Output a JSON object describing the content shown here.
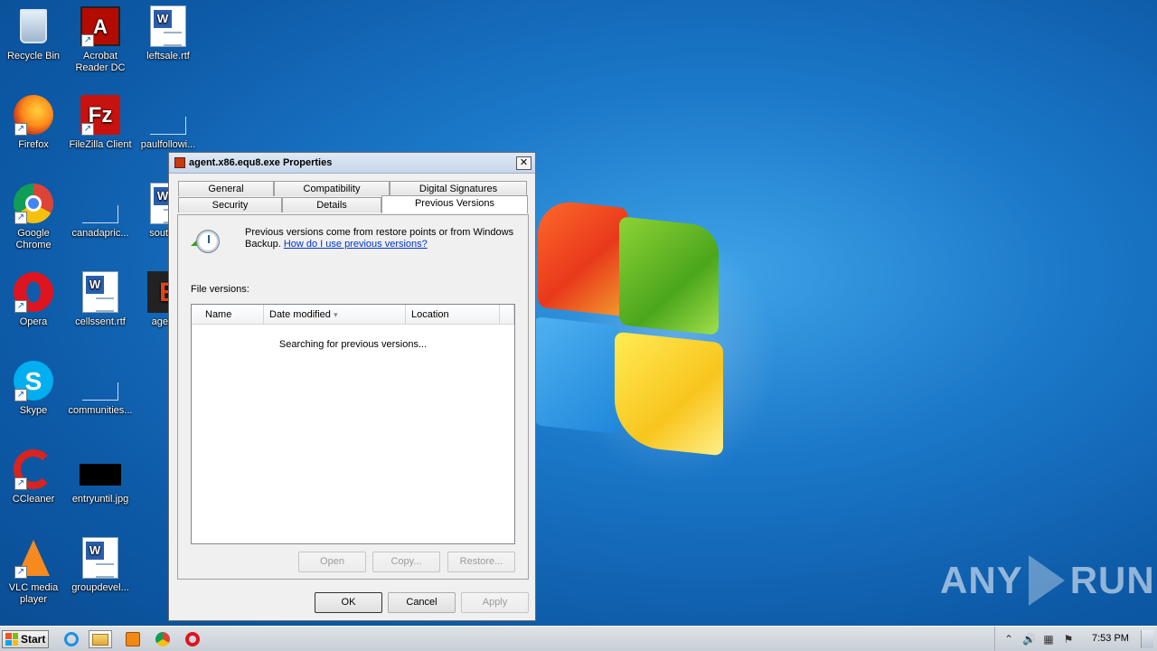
{
  "desktop": {
    "icons": [
      {
        "label": "Recycle Bin",
        "icon": "recycle-bin-icon"
      },
      {
        "label": "Acrobat Reader DC",
        "icon": "acrobat-icon"
      },
      {
        "label": "leftsale.rtf",
        "icon": "word-doc-icon"
      },
      {
        "label": "Firefox",
        "icon": "firefox-icon"
      },
      {
        "label": "FileZilla Client",
        "icon": "filezilla-icon"
      },
      {
        "label": "paulfollowi...",
        "icon": "file-icon"
      },
      {
        "label": "Google Chrome",
        "icon": "chrome-icon"
      },
      {
        "label": "canadapric...",
        "icon": "file-icon"
      },
      {
        "label": "souths...",
        "icon": "word-doc-icon"
      },
      {
        "label": "Opera",
        "icon": "opera-icon"
      },
      {
        "label": "cellssent.rtf",
        "icon": "word-doc-icon"
      },
      {
        "label": "agent...",
        "icon": "agent-exe-icon"
      },
      {
        "label": "Skype",
        "icon": "skype-icon"
      },
      {
        "label": "communities...",
        "icon": "file-icon"
      },
      {
        "label": "CCleaner",
        "icon": "ccleaner-icon"
      },
      {
        "label": "entryuntil.jpg",
        "icon": "image-icon"
      },
      {
        "label": "VLC media player",
        "icon": "vlc-icon"
      },
      {
        "label": "groupdevel...",
        "icon": "word-doc-icon"
      }
    ]
  },
  "dialog": {
    "title": "agent.x86.equ8.exe Properties",
    "close_label": "✕",
    "tabs": {
      "general": "General",
      "compatibility": "Compatibility",
      "digital_signatures": "Digital Signatures",
      "security": "Security",
      "details": "Details",
      "previous_versions": "Previous Versions"
    },
    "active_tab": "Previous Versions",
    "info_text": "Previous versions come from restore points or from Windows Backup.",
    "help_link": "How do I use previous versions?",
    "file_versions_label": "File versions:",
    "columns": [
      "Name",
      "Date modified",
      "Location"
    ],
    "sort_indicator": "▾",
    "list_message": "Searching for previous versions...",
    "buttons": {
      "open": "Open",
      "copy": "Copy...",
      "restore": "Restore...",
      "ok": "OK",
      "cancel": "Cancel",
      "apply": "Apply"
    }
  },
  "watermark": {
    "left": "ANY",
    "right": "RUN"
  },
  "taskbar": {
    "start_label": "Start",
    "pinned": [
      "internet-explorer-icon",
      "explorer-icon",
      "media-player-icon",
      "chrome-icon",
      "opera-icon"
    ],
    "tray": {
      "expand": "⌃",
      "time": "7:53 PM"
    }
  },
  "colors": {
    "desktop_accent": "#1b78c9",
    "link": "#0033cc",
    "taskbar": "#d4d9df"
  }
}
